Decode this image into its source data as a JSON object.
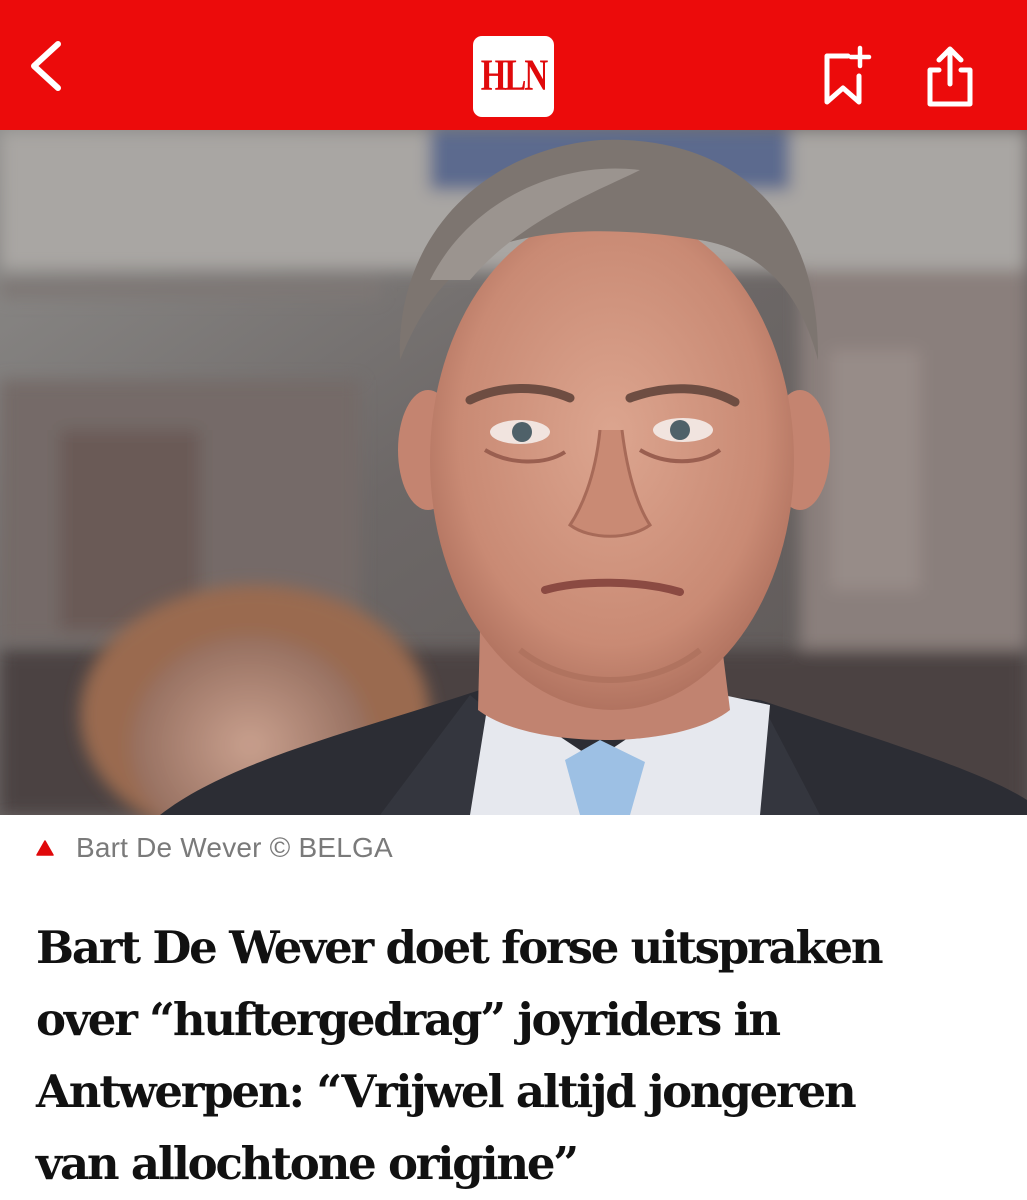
{
  "header": {
    "logo_text": "HLN",
    "back_icon": "chevron-left-icon",
    "bookmark_icon": "bookmark-add-icon",
    "share_icon": "share-icon",
    "bar_color": "#ec0b0b"
  },
  "article": {
    "image": {
      "description_icon": "photo",
      "caption": "Bart De Wever © BELGA",
      "caption_icon": "triangle-up-icon",
      "caption_icon_color": "#e0090b"
    },
    "headline_lines": [
      "Bart De Wever doet forse uitspraken",
      "over “huftergedrag” joyriders in",
      "Antwerpen: “Vrijwel altijd jongeren",
      "van allochtone origine”"
    ]
  }
}
